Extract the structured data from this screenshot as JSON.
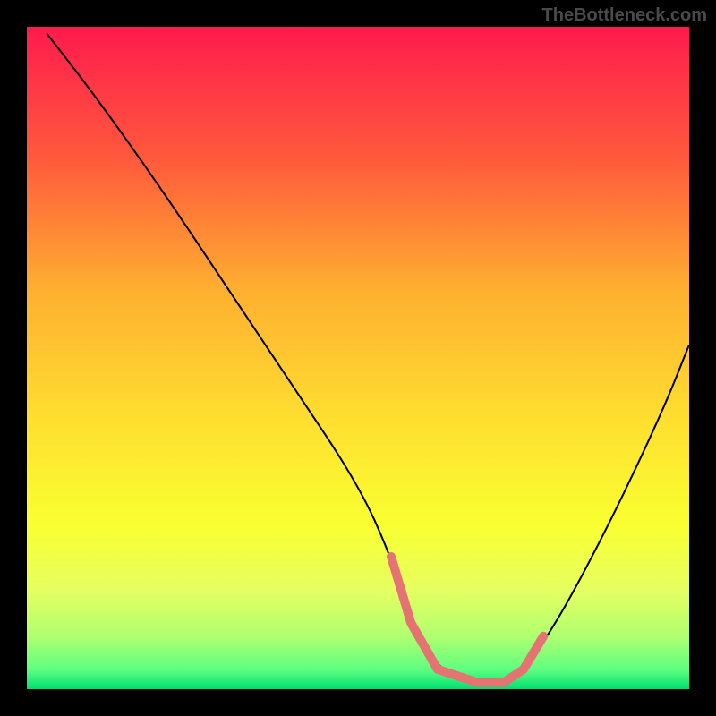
{
  "watermark": "TheBottleneck.com",
  "chart_data": {
    "type": "line",
    "title": "",
    "xlabel": "",
    "ylabel": "",
    "xlim": [
      0,
      100
    ],
    "ylim": [
      0,
      100
    ],
    "grid": false,
    "legend": false,
    "gradient_stops": [
      {
        "offset": 0,
        "color": "#ff1a4d"
      },
      {
        "offset": 20,
        "color": "#ff5a3c"
      },
      {
        "offset": 40,
        "color": "#ffb030"
      },
      {
        "offset": 60,
        "color": "#ffe030"
      },
      {
        "offset": 75,
        "color": "#f9ff30"
      },
      {
        "offset": 85,
        "color": "#e6ff60"
      },
      {
        "offset": 92,
        "color": "#b0ff70"
      },
      {
        "offset": 97,
        "color": "#60ff80"
      },
      {
        "offset": 100,
        "color": "#00e070"
      }
    ],
    "curve": {
      "x": [
        3,
        10,
        20,
        30,
        40,
        50,
        55,
        58,
        62,
        68,
        72,
        75,
        80,
        88,
        96,
        100
      ],
      "y": [
        99,
        90,
        76,
        61,
        46,
        31,
        20,
        10,
        3,
        1,
        1,
        3,
        10,
        25,
        42,
        52
      ]
    },
    "highlight_segments": [
      {
        "x": [
          55,
          58,
          62
        ],
        "y": [
          20,
          10,
          3
        ],
        "color": "#e57373"
      },
      {
        "x": [
          62,
          68,
          72
        ],
        "y": [
          3,
          1,
          1
        ],
        "color": "#e57373"
      },
      {
        "x": [
          72,
          75,
          78
        ],
        "y": [
          1,
          3,
          8
        ],
        "color": "#e57373"
      }
    ]
  }
}
